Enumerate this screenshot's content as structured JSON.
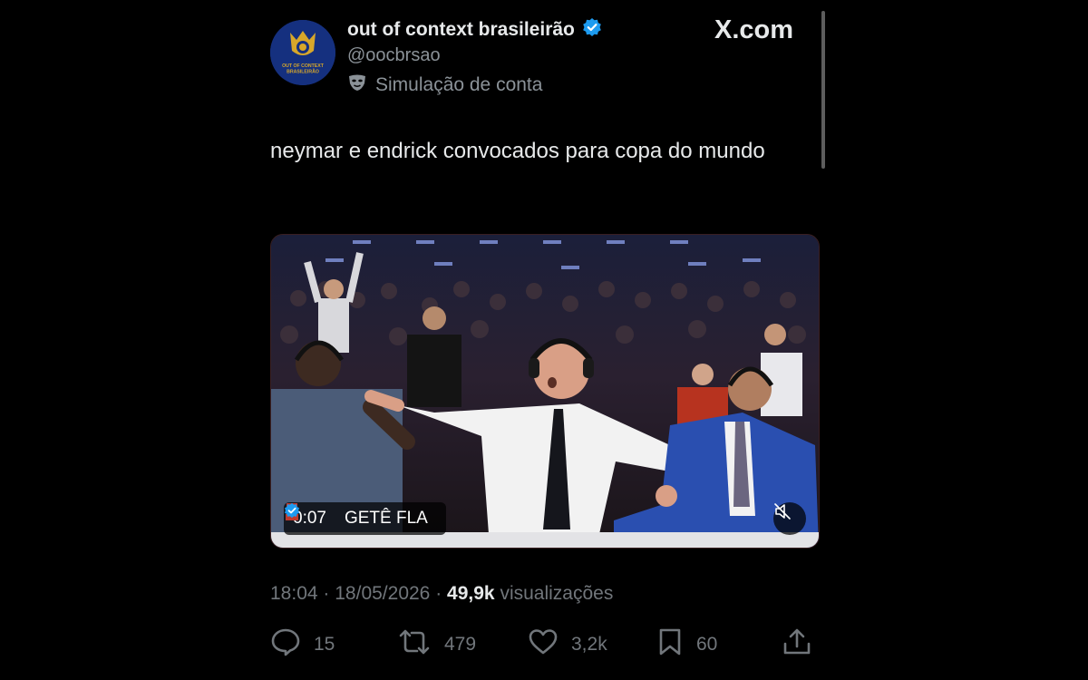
{
  "account": {
    "display_name": "out of context brasileirão",
    "handle": "@oocbrsao",
    "simulation_label": "Simulação de conta",
    "avatar_text_line1": "OUT OF CONTEXT",
    "avatar_text_line2": "BRASILEIRÃO"
  },
  "brand": {
    "site": "X.com"
  },
  "tweet": {
    "text": "neymar e endrick convocados para copa do mundo"
  },
  "video": {
    "time": "0:07",
    "source_name": "GETÊ FLA"
  },
  "meta": {
    "time": "18:04",
    "separator": "·",
    "date": "18/05/2026",
    "views_count": "49,9k",
    "views_label": "visualizações"
  },
  "actions": {
    "replies": "15",
    "reposts": "479",
    "likes": "3,2k",
    "bookmarks": "60"
  },
  "colors": {
    "verified": "#1d9bf0",
    "muted_text": "#71767b",
    "text": "#e7e9ea",
    "background": "#000000"
  },
  "icons": [
    "verified-badge-icon",
    "mask-icon",
    "mute-icon",
    "reply-icon",
    "repost-icon",
    "like-icon",
    "bookmark-icon",
    "share-icon"
  ]
}
